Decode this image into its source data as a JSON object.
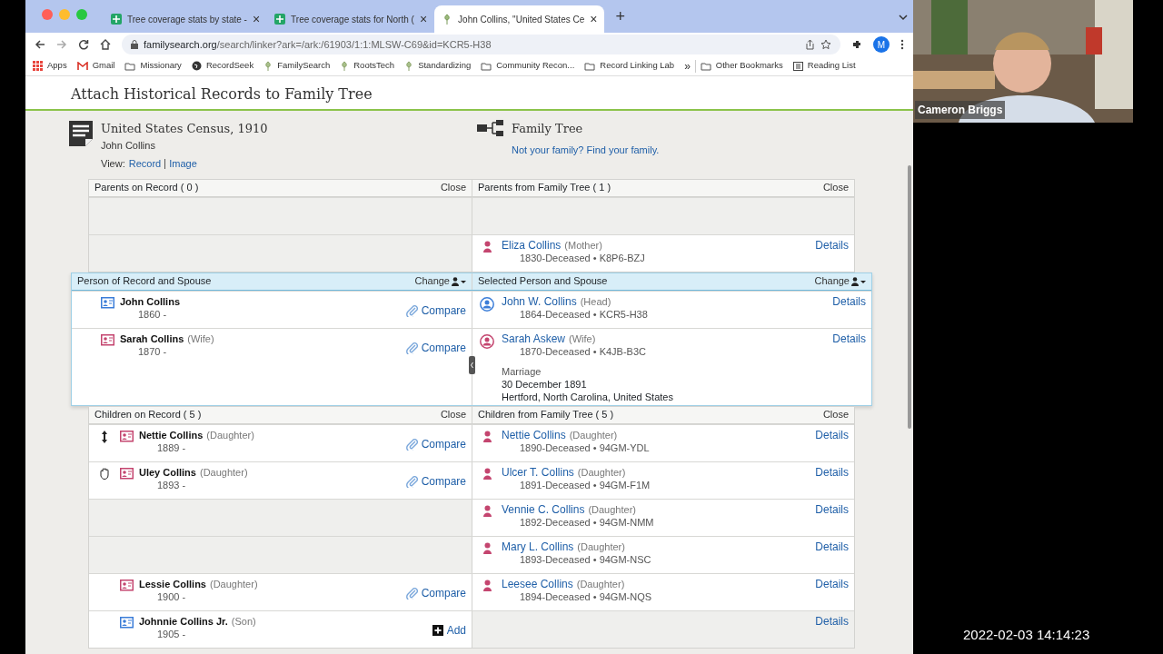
{
  "browser": {
    "tabs": [
      {
        "title": "Tree coverage stats by state -",
        "kind": "sheet",
        "selected": false,
        "close": "×"
      },
      {
        "title": "Tree coverage stats for North (",
        "kind": "sheet",
        "selected": false,
        "close": "×"
      },
      {
        "title": "John Collins, \"United States Ce",
        "kind": "site",
        "selected": true,
        "close": "×"
      }
    ],
    "new_tab": "+",
    "url_host": "familysearch.org",
    "url_path": "/search/linker?ark=/ark:/61903/1:1:MLSW-C69&id=KCR5-H38",
    "profile": "M",
    "bookmarks": [
      {
        "label": "Apps",
        "kind": "apps"
      },
      {
        "label": "Gmail",
        "kind": "mail"
      },
      {
        "label": "Missionary",
        "kind": "folder"
      },
      {
        "label": "RecordSeek",
        "kind": "globe"
      },
      {
        "label": "FamilySearch",
        "kind": "site"
      },
      {
        "label": "RootsTech",
        "kind": "site"
      },
      {
        "label": "Standardizing",
        "kind": "site"
      },
      {
        "label": "Community Recon...",
        "kind": "folder"
      },
      {
        "label": "Record Linking Lab",
        "kind": "folder"
      }
    ],
    "overflow": "»",
    "extra_bookmarks": [
      {
        "label": "Other Bookmarks",
        "kind": "folder"
      },
      {
        "label": "Reading List",
        "kind": "list"
      }
    ]
  },
  "page": {
    "title": "Attach Historical Records to Family Tree",
    "record": {
      "title": "United States Census, 1910",
      "person": "John Collins",
      "view_label": "View:",
      "view_links": [
        "Record",
        "Image"
      ]
    },
    "tree": {
      "title": "Family Tree",
      "link": "Not your family? Find your family."
    },
    "sections": [
      {
        "kind": "parents",
        "left_title": "Parents on Record  ( 0 )",
        "left_action": "Close",
        "right_title": "Parents from Family Tree  ( 1 )",
        "right_action": "Close",
        "rows": [
          {
            "record": null,
            "tree": null
          },
          {
            "record": null,
            "tree": {
              "name": "Eliza Collins",
              "role": "(Mother)",
              "color": "#c4456f",
              "dates": "1830-Deceased • K8P6-BZJ",
              "details": "Details"
            }
          }
        ]
      },
      {
        "kind": "spouse",
        "left_title": "Person of Record and Spouse",
        "left_action": "Change",
        "right_title": "Selected Person and Spouse",
        "right_action": "Change",
        "rows": [
          {
            "record": {
              "name": "John Collins",
              "color": "#3b7dd8",
              "dates": "1860 -",
              "action": {
                "kind": "compare",
                "label": "Compare"
              }
            },
            "tree": {
              "name": "John W. Collins",
              "role": "(Head)",
              "color": "#3b7dd8",
              "dates": "1864-Deceased • KCR5-H38",
              "details": "Details"
            }
          },
          {
            "record": {
              "name": "Sarah Collins",
              "role": "(Wife)",
              "color": "#c4456f",
              "dates": "1870 -",
              "action": {
                "kind": "compare",
                "label": "Compare"
              }
            },
            "tree": {
              "name": "Sarah Askew",
              "role": "(Wife)",
              "color": "#c4456f",
              "dates": "1870-Deceased • K4JB-B3C",
              "details": "Details",
              "marriage": [
                "Marriage",
                "30 December 1891",
                "Hertford, North Carolina, United States"
              ]
            }
          }
        ]
      },
      {
        "kind": "children",
        "left_title": "Children on Record  ( 5 )",
        "left_action": "Close",
        "right_title": "Children from Family Tree  ( 5 )",
        "right_action": "Close",
        "rows": [
          {
            "record": {
              "kind": "move",
              "name": "Nettie Collins",
              "role": "(Daughter)",
              "color": "#c4456f",
              "dates": "1889 -",
              "action": {
                "kind": "compare",
                "label": "Compare"
              }
            },
            "tree": {
              "name": "Nettie Collins",
              "role": "(Daughter)",
              "color": "#c4456f",
              "dates": "1890-Deceased • 94GM-YDL",
              "details": "Details"
            }
          },
          {
            "record": {
              "kind": "grab",
              "name": "Uley Collins",
              "role": "(Daughter)",
              "color": "#c4456f",
              "dates": "1893 -",
              "action": {
                "kind": "compare",
                "label": "Compare"
              }
            },
            "tree": {
              "name": "Ulcer T. Collins",
              "role": "(Daughter)",
              "color": "#c4456f",
              "dates": "1891-Deceased • 94GM-F1M",
              "details": "Details"
            }
          },
          {
            "record": null,
            "tree": {
              "name": "Vennie C. Collins",
              "role": "(Daughter)",
              "color": "#c4456f",
              "dates": "1892-Deceased • 94GM-NMM",
              "details": "Details"
            }
          },
          {
            "record": null,
            "tree": {
              "name": "Mary L. Collins",
              "role": "(Daughter)",
              "color": "#c4456f",
              "dates": "1893-Deceased • 94GM-NSC",
              "details": "Details"
            }
          },
          {
            "record": {
              "name": "Lessie Collins",
              "role": "(Daughter)",
              "color": "#c4456f",
              "dates": "1900 -",
              "action": {
                "kind": "compare",
                "label": "Compare"
              }
            },
            "tree": {
              "name": "Leesee Collins",
              "role": "(Daughter)",
              "color": "#c4456f",
              "dates": "1894-Deceased • 94GM-NQS",
              "details": "Details"
            }
          },
          {
            "record": {
              "name": "Johnnie Collins Jr.",
              "role": "(Son)",
              "color": "#3b7dd8",
              "dates": "1905 -",
              "action": {
                "kind": "add",
                "label": "Add"
              }
            },
            "tree": {
              "details": "Details"
            }
          }
        ]
      }
    ]
  },
  "video": {
    "kind": "picture",
    "name": "Cameron Briggs"
  },
  "timestamp": "2022-02-03 14:14:23"
}
